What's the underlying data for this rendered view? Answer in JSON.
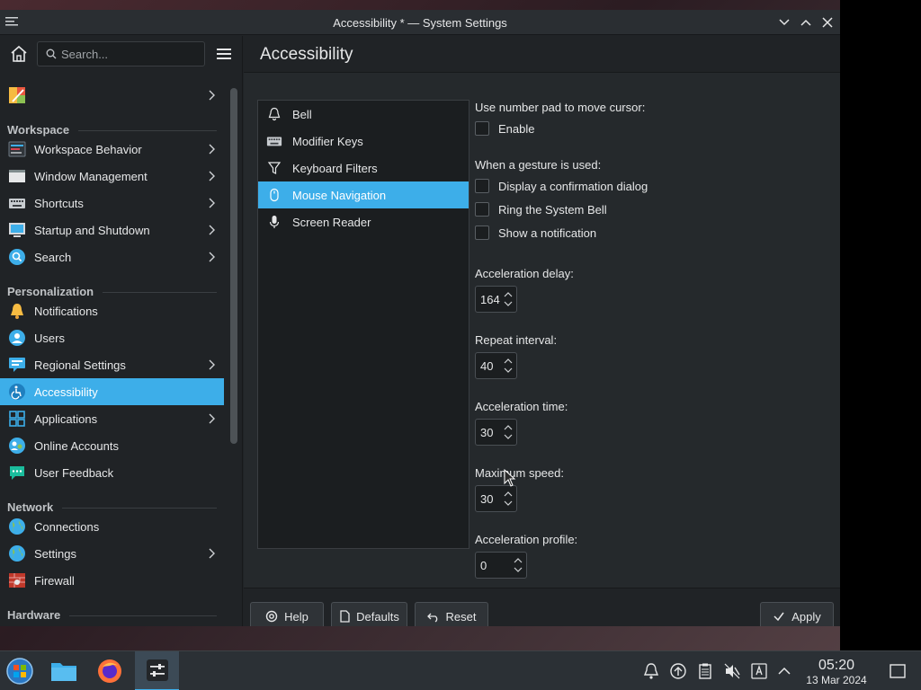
{
  "window": {
    "title": "Accessibility * — System Settings"
  },
  "sidebar": {
    "search_placeholder": "Search...",
    "items": [
      {
        "type": "item",
        "label": "",
        "icon": "colors-icon",
        "chevron": true
      },
      {
        "type": "category",
        "label": "Workspace"
      },
      {
        "type": "item",
        "label": "Workspace Behavior",
        "icon": "workspace-behavior-icon",
        "chevron": true
      },
      {
        "type": "item",
        "label": "Window Management",
        "icon": "window-management-icon",
        "chevron": true
      },
      {
        "type": "item",
        "label": "Shortcuts",
        "icon": "keyboard-icon",
        "chevron": true
      },
      {
        "type": "item",
        "label": "Startup and Shutdown",
        "icon": "startup-icon",
        "chevron": true
      },
      {
        "type": "item",
        "label": "Search",
        "icon": "search-icon",
        "chevron": true
      },
      {
        "type": "category",
        "label": "Personalization"
      },
      {
        "type": "item",
        "label": "Notifications",
        "icon": "bell-icon",
        "chevron": false
      },
      {
        "type": "item",
        "label": "Users",
        "icon": "user-icon",
        "chevron": false
      },
      {
        "type": "item",
        "label": "Regional Settings",
        "icon": "regional-icon",
        "chevron": true
      },
      {
        "type": "item",
        "label": "Accessibility",
        "icon": "accessibility-icon",
        "chevron": false,
        "active": true
      },
      {
        "type": "item",
        "label": "Applications",
        "icon": "applications-icon",
        "chevron": true
      },
      {
        "type": "item",
        "label": "Online Accounts",
        "icon": "online-accounts-icon",
        "chevron": false
      },
      {
        "type": "item",
        "label": "User Feedback",
        "icon": "feedback-icon",
        "chevron": false
      },
      {
        "type": "category",
        "label": "Network"
      },
      {
        "type": "item",
        "label": "Connections",
        "icon": "globe-icon",
        "chevron": false
      },
      {
        "type": "item",
        "label": "Settings",
        "icon": "globe-icon",
        "chevron": true
      },
      {
        "type": "item",
        "label": "Firewall",
        "icon": "firewall-icon",
        "chevron": false
      },
      {
        "type": "category",
        "label": "Hardware"
      }
    ]
  },
  "main": {
    "title": "Accessibility",
    "modules": [
      {
        "label": "Bell",
        "icon": "bell-outline-icon"
      },
      {
        "label": "Modifier Keys",
        "icon": "keyboard-icon"
      },
      {
        "label": "Keyboard Filters",
        "icon": "filter-icon"
      },
      {
        "label": "Mouse Navigation",
        "icon": "mouse-icon",
        "active": true
      },
      {
        "label": "Screen Reader",
        "icon": "microphone-icon"
      }
    ],
    "numpad_label": "Use number pad to move cursor:",
    "enable_label": "Enable",
    "gesture_label": "When a gesture is used:",
    "gesture_options": [
      "Display a confirmation dialog",
      "Ring the System Bell",
      "Show a notification"
    ],
    "accel_delay_label": "Acceleration delay:",
    "accel_delay_value": "164",
    "repeat_interval_label": "Repeat interval:",
    "repeat_interval_value": "40",
    "accel_time_label": "Acceleration time:",
    "accel_time_value": "30",
    "max_speed_label": "Maximum speed:",
    "max_speed_value": "30",
    "accel_profile_label": "Acceleration profile:",
    "accel_profile_value": "0"
  },
  "footer": {
    "help": "Help",
    "defaults": "Defaults",
    "reset": "Reset",
    "apply": "Apply"
  },
  "taskbar": {
    "time": "05:20",
    "date": "13 Mar 2024"
  },
  "colors": {
    "accent": "#3daee9",
    "window_bg": "#202326",
    "content_bg": "#25292c"
  }
}
